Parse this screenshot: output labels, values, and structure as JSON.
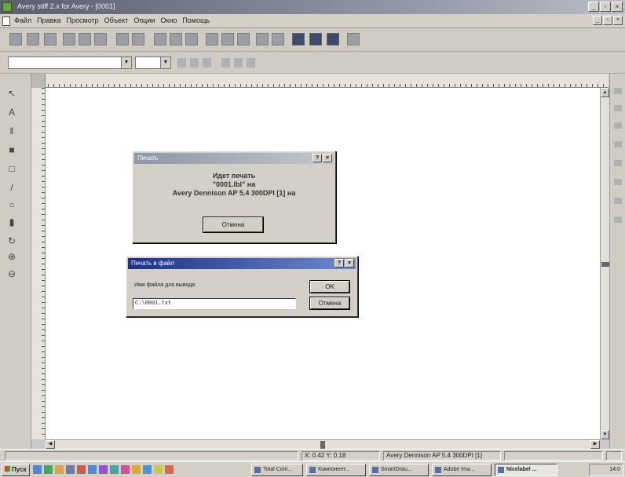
{
  "window": {
    "title": "Avery stiff 2.x for Avery - [0001]",
    "controls": [
      "_",
      "▫",
      "×"
    ]
  },
  "menu": {
    "items": [
      "Файл",
      "Правка",
      "Просмотр",
      "Объект",
      "Опции",
      "Окно",
      "Помощь"
    ],
    "controls": [
      "_",
      "▫",
      "×"
    ]
  },
  "print_dialog": {
    "title": "Печать",
    "help": "?",
    "close": "×",
    "line1": "Идет печать",
    "line2": "\"0001.lbl\" на",
    "line3": "Avery Dennison AP 5.4 300DPI [1] на",
    "cancel": "Отмена"
  },
  "file_dialog": {
    "title": "Печать в файл",
    "help": "?",
    "close": "×",
    "label": "Имя файла для вывода:",
    "value": "C:\\0001.txt",
    "ok": "OK",
    "cancel": "Отмена"
  },
  "status": {
    "coords": "X: 0.42  Y: 0.18",
    "printer": "Avery Dennison AP 5.4 300DPI [1]"
  },
  "taskbar": {
    "start": "Пуск",
    "tasks": [
      "Total Com...",
      "Компонент...",
      "SmartDrau...",
      "Adobe Ima...",
      "Nicelabel ..."
    ],
    "clock": "14:0"
  }
}
